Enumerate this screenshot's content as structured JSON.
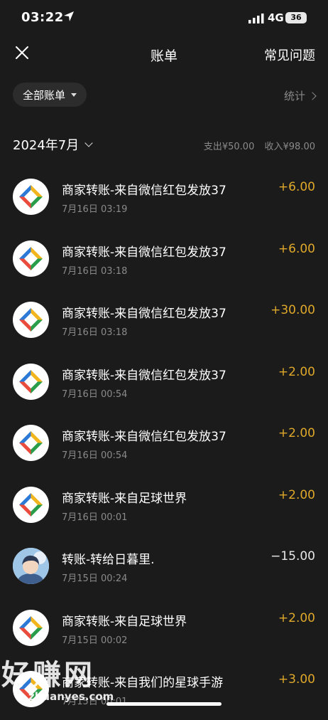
{
  "status": {
    "time": "03:22",
    "network": "4G",
    "battery": "36"
  },
  "header": {
    "title": "账单",
    "faq": "常见问题"
  },
  "filter": {
    "label": "全部账单",
    "stats": "统计"
  },
  "month": {
    "label": "2024年7月",
    "expense": "支出¥50.00",
    "income": "收入¥98.00"
  },
  "transactions": [
    {
      "title": "商家转账-来自微信红包发放37",
      "time": "7月16日 03:19",
      "amount": "+6.00",
      "avatar": "logo"
    },
    {
      "title": "商家转账-来自微信红包发放37",
      "time": "7月16日 03:18",
      "amount": "+6.00",
      "avatar": "logo"
    },
    {
      "title": "商家转账-来自微信红包发放37",
      "time": "7月16日 03:18",
      "amount": "+30.00",
      "avatar": "logo"
    },
    {
      "title": "商家转账-来自微信红包发放37",
      "time": "7月16日 00:54",
      "amount": "+2.00",
      "avatar": "logo"
    },
    {
      "title": "商家转账-来自微信红包发放37",
      "time": "7月16日 00:54",
      "amount": "+2.00",
      "avatar": "logo"
    },
    {
      "title": "商家转账-来自足球世界",
      "time": "7月16日 00:01",
      "amount": "+2.00",
      "avatar": "logo"
    },
    {
      "title": "转账-转给日暮里.",
      "time": "7月15日 00:24",
      "amount": "−15.00",
      "avatar": "photo"
    },
    {
      "title": "商家转账-来自足球世界",
      "time": "7月15日 00:02",
      "amount": "+2.00",
      "avatar": "logo"
    },
    {
      "title": "商家转账-来自我们的星球手游",
      "time": "7月15日 00:01",
      "amount": "+3.00",
      "avatar": "logo"
    }
  ],
  "watermark": {
    "big": "好赚网",
    "small": "zhuanyes.com"
  },
  "colors": {
    "background": "#1b1b1b",
    "income": "#e0a92a",
    "muted": "#8a8a8a"
  }
}
